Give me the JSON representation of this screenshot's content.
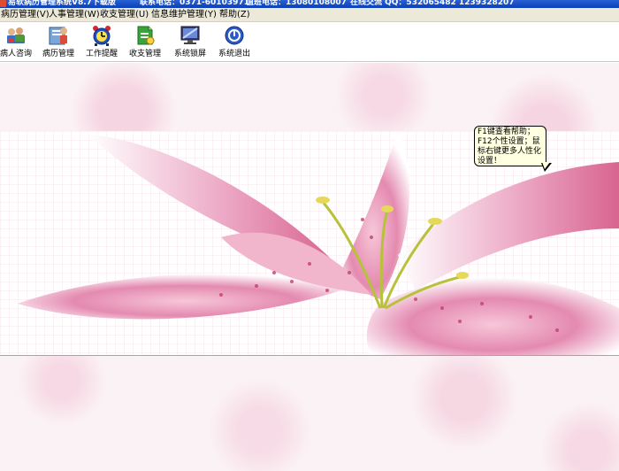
{
  "titlebar": {
    "title": "易软病历管理系统V8.7下载版",
    "contact": "联系电话：0371-60103971",
    "duty": "值班电话：13080108007",
    "online": "在线交流  QQ：532065482  1239328207"
  },
  "menu": [
    {
      "label": "病历管理(V)"
    },
    {
      "label": "人事管理(W)"
    },
    {
      "label": "收支管理(U)"
    },
    {
      "label": "信息维护管理(Y)"
    },
    {
      "label": "帮助(Z)"
    }
  ],
  "toolbar": [
    {
      "label": "病人咨询",
      "icon": "patient-consult-icon"
    },
    {
      "label": "病历管理",
      "icon": "medical-record-icon"
    },
    {
      "label": "工作提醒",
      "icon": "alarm-clock-icon"
    },
    {
      "label": "收支管理",
      "icon": "finance-document-icon"
    },
    {
      "label": "系统锁屏",
      "icon": "monitor-lock-icon"
    },
    {
      "label": "系统退出",
      "icon": "power-exit-icon"
    }
  ],
  "tooltip": {
    "text": "F1键查看帮助；F12个性设置；鼠标右键更多人性化设置！"
  },
  "colors": {
    "titlebar": "#0a3fb8",
    "menubar": "#ece9d8",
    "tooltip_bg": "#ffffe1",
    "petal": "#e58db0"
  }
}
